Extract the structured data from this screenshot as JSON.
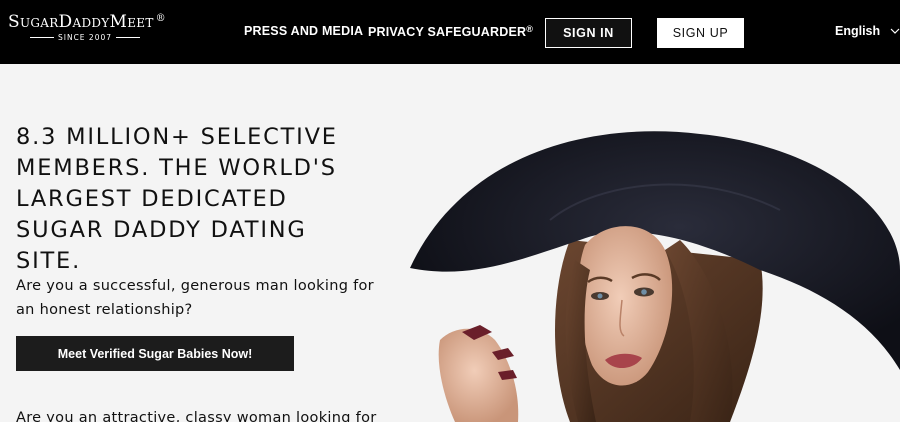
{
  "brand": {
    "name": "SugarDaddyMeet",
    "registered": "®",
    "since": "SINCE 2007"
  },
  "nav": {
    "press": "PRESS AND MEDIA",
    "privacy": "PRIVACY SAFEGUARDER",
    "privacy_mark": "®",
    "sign_in": "SIGN IN",
    "sign_up": "SIGN UP",
    "language": "English"
  },
  "hero": {
    "title": "8.3 MILLION+ SELECTIVE MEMBERS. THE WORLD'S LARGEST DEDICATED SUGAR DADDY DATING SITE.",
    "men_prompt": "Are you a successful, generous man looking for an honest relationship?",
    "men_cta": "Meet Verified Sugar Babies Now!",
    "women_prompt": "Are you an attractive, classy woman looking for"
  },
  "colors": {
    "header_bg": "#000000",
    "page_bg": "#f4f4f4",
    "cta_bg": "#1c1c1c"
  },
  "icons": {
    "language_caret": "chevron-down-icon"
  }
}
